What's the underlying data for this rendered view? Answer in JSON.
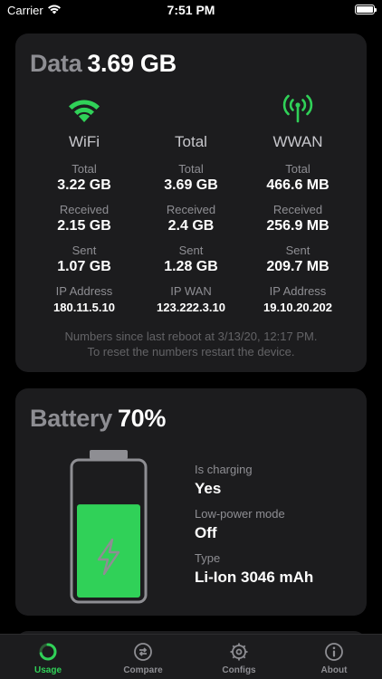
{
  "status_bar": {
    "carrier": "Carrier",
    "time": "7:51 PM"
  },
  "colors": {
    "accent_green": "#30d158",
    "card_bg": "#1c1c1e",
    "secondary_text": "#8e8e93"
  },
  "data_card": {
    "title": "Data",
    "total_value": "3.69 GB",
    "columns": [
      {
        "name": "WiFi",
        "icon": "wifi-icon",
        "metrics": [
          {
            "label": "Total",
            "value": "3.22 GB"
          },
          {
            "label": "Received",
            "value": "2.15 GB"
          },
          {
            "label": "Sent",
            "value": "1.07 GB"
          },
          {
            "label": "IP Address",
            "value": "180.11.5.10"
          }
        ]
      },
      {
        "name": "Total",
        "icon": "",
        "metrics": [
          {
            "label": "Total",
            "value": "3.69 GB"
          },
          {
            "label": "Received",
            "value": "2.4 GB"
          },
          {
            "label": "Sent",
            "value": "1.28 GB"
          },
          {
            "label": "IP WAN",
            "value": "123.222.3.10"
          }
        ]
      },
      {
        "name": "WWAN",
        "icon": "cellular-antenna-icon",
        "metrics": [
          {
            "label": "Total",
            "value": "466.6 MB"
          },
          {
            "label": "Received",
            "value": "256.9 MB"
          },
          {
            "label": "Sent",
            "value": "209.7 MB"
          },
          {
            "label": "IP Address",
            "value": "19.10.20.202"
          }
        ]
      }
    ],
    "note_line1": "Numbers since last reboot at 3/13/20, 12:17 PM.",
    "note_line2": "To reset the numbers restart the device."
  },
  "battery_card": {
    "title": "Battery",
    "level_text": "70%",
    "level_fraction": 0.7,
    "icon": "lightning-bolt-icon",
    "info": [
      {
        "label": "Is charging",
        "value": "Yes"
      },
      {
        "label": "Low-power mode",
        "value": "Off"
      },
      {
        "label": "Type",
        "value": "Li-Ion 3046 mAh"
      }
    ]
  },
  "tab_bar": {
    "tabs": [
      {
        "label": "Usage",
        "icon": "usage-ring-icon",
        "active": true
      },
      {
        "label": "Compare",
        "icon": "compare-icon",
        "active": false
      },
      {
        "label": "Configs",
        "icon": "gear-icon",
        "active": false
      },
      {
        "label": "About",
        "icon": "info-icon",
        "active": false
      }
    ]
  }
}
